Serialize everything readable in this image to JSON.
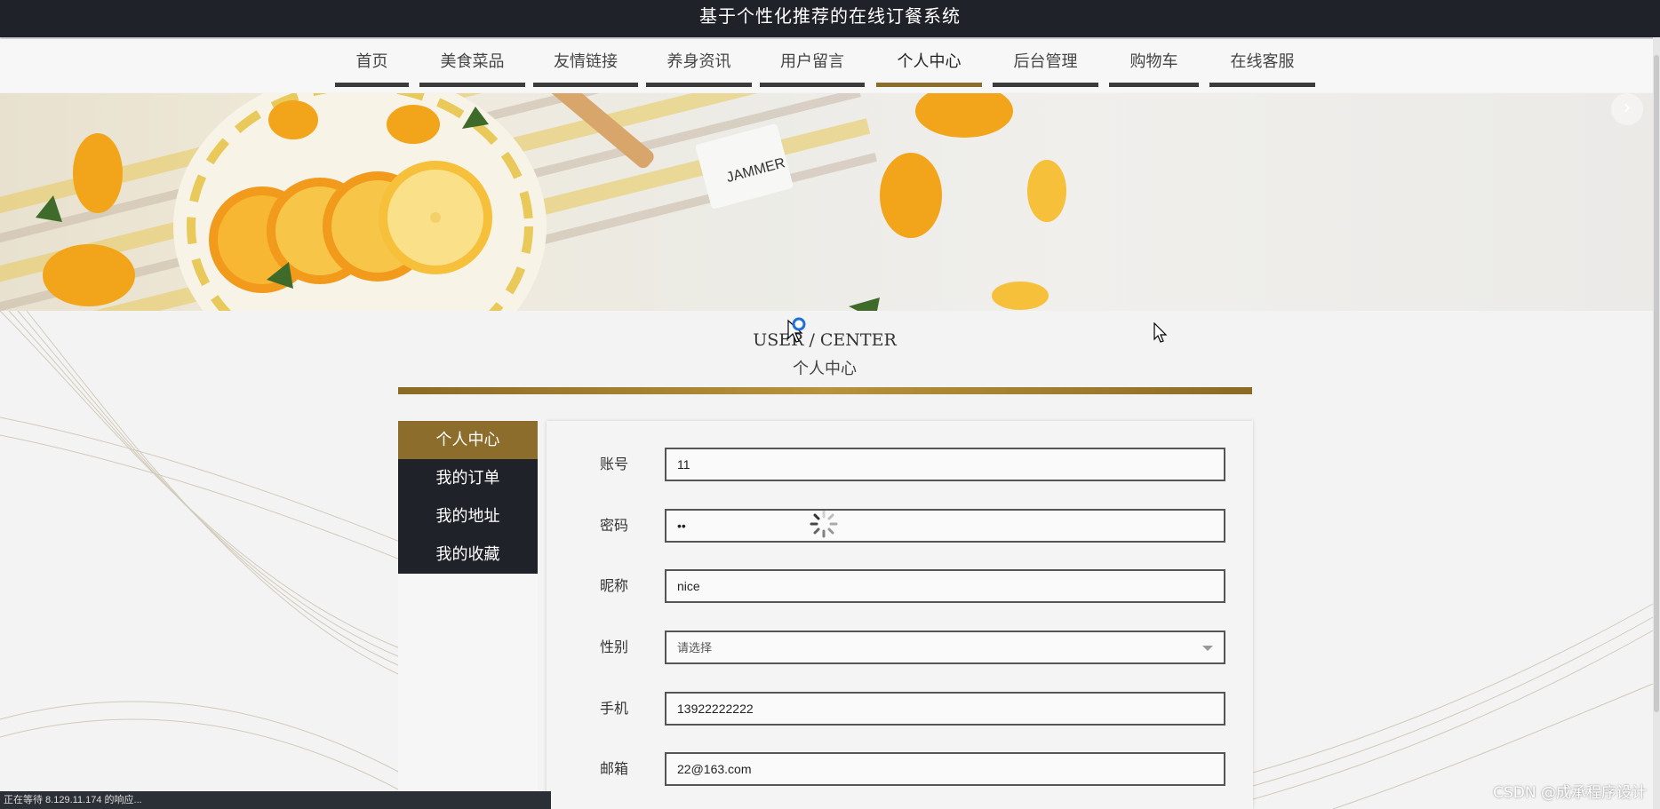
{
  "app": {
    "title": "基于个性化推荐的在线订餐系统"
  },
  "nav": {
    "items": [
      {
        "label": "首页"
      },
      {
        "label": "美食菜品"
      },
      {
        "label": "友情链接"
      },
      {
        "label": "养身资讯"
      },
      {
        "label": "用户留言"
      },
      {
        "label": "个人中心",
        "active": true
      },
      {
        "label": "后台管理"
      },
      {
        "label": "购物车"
      },
      {
        "label": "在线客服"
      }
    ]
  },
  "section": {
    "title_en": "USER / CENTER",
    "title_zh": "个人中心"
  },
  "sidebar": {
    "items": [
      {
        "label": "个人中心",
        "active": true
      },
      {
        "label": "我的订单"
      },
      {
        "label": "我的地址"
      },
      {
        "label": "我的收藏"
      }
    ]
  },
  "form": {
    "account": {
      "label": "账号",
      "value": "11"
    },
    "password": {
      "label": "密码",
      "value": "••"
    },
    "nickname": {
      "label": "昵称",
      "value": "nice"
    },
    "gender": {
      "label": "性别",
      "value": "请选择"
    },
    "phone": {
      "label": "手机",
      "value": "13922222222"
    },
    "email": {
      "label": "邮箱",
      "value": "22@163.com"
    }
  },
  "statusbar": {
    "text": "正在等待 8.129.11.174 的响应..."
  },
  "watermark": {
    "text": "CSDN @成承程序设计"
  },
  "colors": {
    "accent": "#8c6d2b",
    "dark": "#1f2329"
  },
  "icons": {
    "banner_next": "chevron-right-icon",
    "banner_prev": "chevron-left-icon",
    "loading": "spinner-icon"
  }
}
